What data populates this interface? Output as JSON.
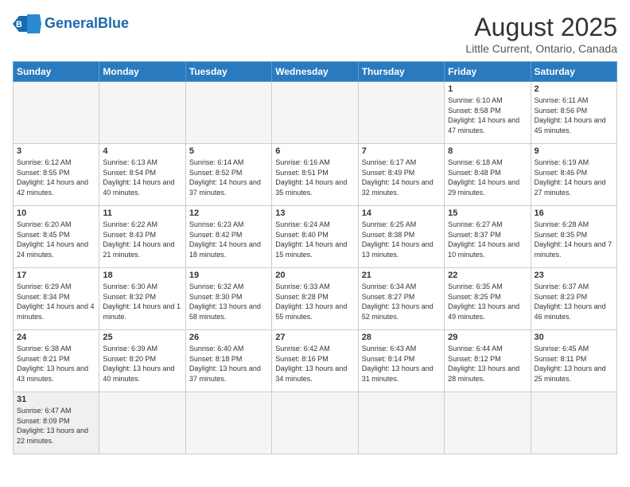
{
  "header": {
    "logo_general": "General",
    "logo_blue": "Blue",
    "title": "August 2025",
    "subtitle": "Little Current, Ontario, Canada"
  },
  "days_of_week": [
    "Sunday",
    "Monday",
    "Tuesday",
    "Wednesday",
    "Thursday",
    "Friday",
    "Saturday"
  ],
  "weeks": [
    [
      {
        "day": "",
        "info": ""
      },
      {
        "day": "",
        "info": ""
      },
      {
        "day": "",
        "info": ""
      },
      {
        "day": "",
        "info": ""
      },
      {
        "day": "",
        "info": ""
      },
      {
        "day": "1",
        "info": "Sunrise: 6:10 AM\nSunset: 8:58 PM\nDaylight: 14 hours and 47 minutes."
      },
      {
        "day": "2",
        "info": "Sunrise: 6:11 AM\nSunset: 8:56 PM\nDaylight: 14 hours and 45 minutes."
      }
    ],
    [
      {
        "day": "3",
        "info": "Sunrise: 6:12 AM\nSunset: 8:55 PM\nDaylight: 14 hours and 42 minutes."
      },
      {
        "day": "4",
        "info": "Sunrise: 6:13 AM\nSunset: 8:54 PM\nDaylight: 14 hours and 40 minutes."
      },
      {
        "day": "5",
        "info": "Sunrise: 6:14 AM\nSunset: 8:52 PM\nDaylight: 14 hours and 37 minutes."
      },
      {
        "day": "6",
        "info": "Sunrise: 6:16 AM\nSunset: 8:51 PM\nDaylight: 14 hours and 35 minutes."
      },
      {
        "day": "7",
        "info": "Sunrise: 6:17 AM\nSunset: 8:49 PM\nDaylight: 14 hours and 32 minutes."
      },
      {
        "day": "8",
        "info": "Sunrise: 6:18 AM\nSunset: 8:48 PM\nDaylight: 14 hours and 29 minutes."
      },
      {
        "day": "9",
        "info": "Sunrise: 6:19 AM\nSunset: 8:46 PM\nDaylight: 14 hours and 27 minutes."
      }
    ],
    [
      {
        "day": "10",
        "info": "Sunrise: 6:20 AM\nSunset: 8:45 PM\nDaylight: 14 hours and 24 minutes."
      },
      {
        "day": "11",
        "info": "Sunrise: 6:22 AM\nSunset: 8:43 PM\nDaylight: 14 hours and 21 minutes."
      },
      {
        "day": "12",
        "info": "Sunrise: 6:23 AM\nSunset: 8:42 PM\nDaylight: 14 hours and 18 minutes."
      },
      {
        "day": "13",
        "info": "Sunrise: 6:24 AM\nSunset: 8:40 PM\nDaylight: 14 hours and 15 minutes."
      },
      {
        "day": "14",
        "info": "Sunrise: 6:25 AM\nSunset: 8:38 PM\nDaylight: 14 hours and 13 minutes."
      },
      {
        "day": "15",
        "info": "Sunrise: 6:27 AM\nSunset: 8:37 PM\nDaylight: 14 hours and 10 minutes."
      },
      {
        "day": "16",
        "info": "Sunrise: 6:28 AM\nSunset: 8:35 PM\nDaylight: 14 hours and 7 minutes."
      }
    ],
    [
      {
        "day": "17",
        "info": "Sunrise: 6:29 AM\nSunset: 8:34 PM\nDaylight: 14 hours and 4 minutes."
      },
      {
        "day": "18",
        "info": "Sunrise: 6:30 AM\nSunset: 8:32 PM\nDaylight: 14 hours and 1 minute."
      },
      {
        "day": "19",
        "info": "Sunrise: 6:32 AM\nSunset: 8:30 PM\nDaylight: 13 hours and 58 minutes."
      },
      {
        "day": "20",
        "info": "Sunrise: 6:33 AM\nSunset: 8:28 PM\nDaylight: 13 hours and 55 minutes."
      },
      {
        "day": "21",
        "info": "Sunrise: 6:34 AM\nSunset: 8:27 PM\nDaylight: 13 hours and 52 minutes."
      },
      {
        "day": "22",
        "info": "Sunrise: 6:35 AM\nSunset: 8:25 PM\nDaylight: 13 hours and 49 minutes."
      },
      {
        "day": "23",
        "info": "Sunrise: 6:37 AM\nSunset: 8:23 PM\nDaylight: 13 hours and 46 minutes."
      }
    ],
    [
      {
        "day": "24",
        "info": "Sunrise: 6:38 AM\nSunset: 8:21 PM\nDaylight: 13 hours and 43 minutes."
      },
      {
        "day": "25",
        "info": "Sunrise: 6:39 AM\nSunset: 8:20 PM\nDaylight: 13 hours and 40 minutes."
      },
      {
        "day": "26",
        "info": "Sunrise: 6:40 AM\nSunset: 8:18 PM\nDaylight: 13 hours and 37 minutes."
      },
      {
        "day": "27",
        "info": "Sunrise: 6:42 AM\nSunset: 8:16 PM\nDaylight: 13 hours and 34 minutes."
      },
      {
        "day": "28",
        "info": "Sunrise: 6:43 AM\nSunset: 8:14 PM\nDaylight: 13 hours and 31 minutes."
      },
      {
        "day": "29",
        "info": "Sunrise: 6:44 AM\nSunset: 8:12 PM\nDaylight: 13 hours and 28 minutes."
      },
      {
        "day": "30",
        "info": "Sunrise: 6:45 AM\nSunset: 8:11 PM\nDaylight: 13 hours and 25 minutes."
      }
    ],
    [
      {
        "day": "31",
        "info": "Sunrise: 6:47 AM\nSunset: 8:09 PM\nDaylight: 13 hours and 22 minutes."
      },
      {
        "day": "",
        "info": ""
      },
      {
        "day": "",
        "info": ""
      },
      {
        "day": "",
        "info": ""
      },
      {
        "day": "",
        "info": ""
      },
      {
        "day": "",
        "info": ""
      },
      {
        "day": "",
        "info": ""
      }
    ]
  ]
}
